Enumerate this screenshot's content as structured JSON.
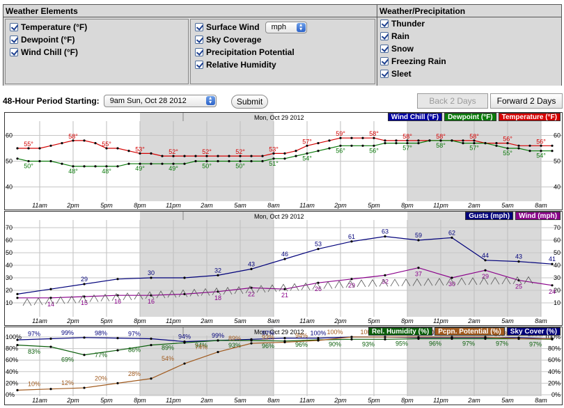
{
  "panels": {
    "weather_elements": {
      "title": "Weather Elements",
      "left_items": [
        "Temperature (°F)",
        "Dewpoint (°F)",
        "Wind Chill (°F)"
      ],
      "middle_items": [
        "Surface Wind",
        "Sky Coverage",
        "Precipitation Potential",
        "Relative Humidity"
      ],
      "wind_unit": "mph"
    },
    "weather_precip": {
      "title": "Weather/Precipitation",
      "items": [
        "Thunder",
        "Rain",
        "Snow",
        "Freezing Rain",
        "Sleet"
      ]
    }
  },
  "period": {
    "label": "48-Hour Period Starting:",
    "selected": "9am Sun, Oct 28 2012",
    "submit": "Submit",
    "back": "Back 2 Days",
    "forward": "Forward 2 Days"
  },
  "colors": {
    "wind_chill": "#0000a0",
    "dewpoint": "#0a7a0a",
    "temperature": "#d40000",
    "gusts": "#00007a",
    "wind": "#8a008a",
    "humidity": "#0a5e0a",
    "precip": "#a05a1e",
    "sky": "#00007a",
    "night": "#d9d9d9"
  },
  "x_ticks": [
    "11am",
    "2pm",
    "5pm",
    "8pm",
    "11pm",
    "2am",
    "5am",
    "8am",
    "11am",
    "2pm",
    "5pm",
    "8pm",
    "11pm",
    "2am",
    "5am",
    "8am"
  ],
  "charts": {
    "temp": {
      "date_label": "Mon, Oct 29 2012",
      "legend": [
        "Wind Chill (°F)",
        "Dewpoint (°F)",
        "Temperature (°F)"
      ],
      "y_ticks": [
        "60",
        "50",
        "40"
      ]
    },
    "wind": {
      "date_label": "Mon, Oct 29 2012",
      "legend": [
        "Gusts (mph)",
        "Wind (mph)"
      ],
      "y_ticks": [
        "70",
        "60",
        "50",
        "40",
        "30",
        "20",
        "10"
      ]
    },
    "sky": {
      "date_label": "Mon, Oct 29 2012",
      "legend": [
        "Rel. Humidity (%)",
        "Pcpn. Potential (%)",
        "Sky Cover (%)"
      ],
      "y_ticks": [
        "100%",
        "80%",
        "60%",
        "40%",
        "20%",
        "0%"
      ]
    }
  },
  "chart_data": [
    {
      "type": "line",
      "title": "",
      "x": [
        "9am",
        "10am",
        "11am",
        "12pm",
        "1pm",
        "2pm",
        "3pm",
        "4pm",
        "5pm",
        "6pm",
        "7pm",
        "8pm",
        "9pm",
        "10pm",
        "11pm",
        "12am",
        "1am",
        "2am",
        "3am",
        "4am",
        "5am",
        "6am",
        "7am",
        "8am",
        "9am",
        "10am",
        "11am",
        "12pm",
        "1pm",
        "2pm",
        "3pm",
        "4pm",
        "5pm",
        "6pm",
        "7pm",
        "8pm",
        "9pm",
        "10pm",
        "11pm",
        "12am",
        "1am",
        "2am",
        "3am",
        "4am",
        "5am",
        "6am",
        "7am",
        "8am",
        "9am"
      ],
      "series": [
        {
          "name": "Temperature (°F)",
          "values": [
            55,
            55,
            55,
            56,
            57,
            58,
            58,
            57,
            55,
            55,
            54,
            53,
            53,
            52,
            52,
            52,
            52,
            52,
            52,
            52,
            52,
            52,
            52,
            53,
            53,
            54,
            56,
            57,
            58,
            59,
            59,
            59,
            59,
            58,
            58,
            58,
            58,
            58,
            58,
            58,
            58,
            58,
            57,
            57,
            57,
            56,
            56,
            56,
            56
          ],
          "labels": {
            "1": "55°",
            "5": "58°",
            "8": "55°",
            "11": "53°",
            "14": "52°",
            "17": "52°",
            "20": "52°",
            "23": "53°",
            "26": "57°",
            "29": "59°",
            "32": "58°",
            "35": "58°",
            "38": "58°",
            "41": "58°",
            "44": "56°",
            "47": "56°"
          }
        },
        {
          "name": "Dewpoint (°F)",
          "values": [
            51,
            50,
            50,
            50,
            49,
            48,
            48,
            48,
            48,
            48,
            49,
            49,
            49,
            49,
            49,
            49,
            50,
            50,
            50,
            50,
            50,
            50,
            50,
            51,
            51,
            52,
            53,
            54,
            55,
            56,
            56,
            56,
            56,
            57,
            57,
            57,
            57,
            58,
            58,
            58,
            57,
            57,
            57,
            56,
            55,
            55,
            54,
            54,
            54
          ],
          "labels": {
            "1": "50°",
            "5": "48°",
            "8": "48°",
            "11": "49°",
            "14": "49°",
            "17": "50°",
            "20": "50°",
            "23": "51°",
            "26": "54°",
            "29": "56°",
            "32": "56°",
            "35": "57°",
            "38": "58°",
            "41": "57°",
            "44": "55°",
            "47": "54°"
          }
        }
      ],
      "ylim": [
        35,
        65
      ],
      "y_ticks_labels": [
        "60",
        "50",
        "40"
      ]
    },
    {
      "type": "line",
      "title": "",
      "x": [
        "9am",
        "12pm",
        "3pm",
        "6pm",
        "9pm",
        "12am",
        "3am",
        "6am",
        "9am",
        "12pm",
        "3pm",
        "6pm",
        "9pm",
        "12am",
        "3am",
        "6am",
        "9am"
      ],
      "series": [
        {
          "name": "Gusts (mph)",
          "values": [
            17,
            21,
            25,
            29,
            30,
            30,
            32,
            37,
            45,
            53,
            59,
            63,
            60,
            62,
            44,
            43,
            41
          ],
          "labels": {
            "2": "29",
            "4": "30",
            "6": "32",
            "7": "43",
            "8": "46",
            "9": "53",
            "10": "61",
            "11": "63",
            "12": "59",
            "13": "62",
            "14": "44",
            "15": "43",
            "16": "41"
          }
        },
        {
          "name": "Wind (mph)",
          "values": [
            14,
            14,
            15,
            16,
            16,
            17,
            19,
            22,
            21,
            26,
            29,
            32,
            38,
            30,
            36,
            28,
            24
          ],
          "labels": {
            "1": "14",
            "2": "15",
            "3": "16",
            "4": "16",
            "6": "18",
            "7": "22",
            "8": "21",
            "9": "26",
            "10": "29",
            "11": "32",
            "12": "37",
            "13": "30",
            "14": "29",
            "15": "25",
            "16": "24"
          }
        }
      ],
      "ylim": [
        0,
        75
      ],
      "y_ticks_labels": [
        "70",
        "60",
        "50",
        "40",
        "30",
        "20",
        "10"
      ]
    },
    {
      "type": "line",
      "title": "",
      "x": [
        "9am",
        "12pm",
        "3pm",
        "6pm",
        "9pm",
        "12am",
        "3am",
        "6am",
        "9am",
        "12pm",
        "3pm",
        "6pm",
        "9pm",
        "12am",
        "3am",
        "6am",
        "9am"
      ],
      "series": [
        {
          "name": "Sky Cover (%)",
          "values": [
            95,
            97,
            99,
            98,
            97,
            92,
            94,
            96,
            98,
            98,
            100,
            100,
            99,
            99,
            99,
            99,
            97
          ],
          "labels": {
            "1": "97%",
            "3": "99%",
            "5": "98%",
            "7": "97%",
            "10": "94%",
            "12": "99%",
            "15": "97%",
            "18": "100%",
            "22": "100%",
            "25": "100%",
            "28": "100%",
            "31": "100%"
          }
        },
        {
          "name": "Rel. Humidity (%)",
          "values": [
            86,
            83,
            69,
            77,
            86,
            90,
            94,
            94,
            93,
            95,
            96,
            96,
            97,
            97,
            97,
            97,
            96
          ],
          "labels": {
            "1": "83%",
            "3": "69%",
            "5": "77%",
            "7": "86%",
            "9": "89%",
            "11": "94%",
            "13": "93%",
            "15": "96%",
            "17": "96%",
            "19": "90%",
            "21": "93%",
            "23": "95%",
            "25": "96%",
            "27": "97%",
            "29": "97%",
            "31": "97%"
          }
        },
        {
          "name": "Pcpn. Potential (%)",
          "values": [
            8,
            10,
            12,
            20,
            28,
            54,
            74,
            89,
            91,
            94,
            100,
            100,
            100,
            100,
            100,
            97,
            97
          ],
          "labels": {
            "1": "10%",
            "3": "12%",
            "5": "20%",
            "7": "28%",
            "9": "54%",
            "11": "74%",
            "13": "89%",
            "15": "93%",
            "17": "94%",
            "19": "100%",
            "21": "100%",
            "23": "100%",
            "25": "100%",
            "27": "100%",
            "29": "100%",
            "31": "97%"
          }
        }
      ],
      "ylim": [
        0,
        100
      ],
      "y_ticks_labels": [
        "100%",
        "80%",
        "60%",
        "40%",
        "20%",
        "0%"
      ]
    }
  ]
}
